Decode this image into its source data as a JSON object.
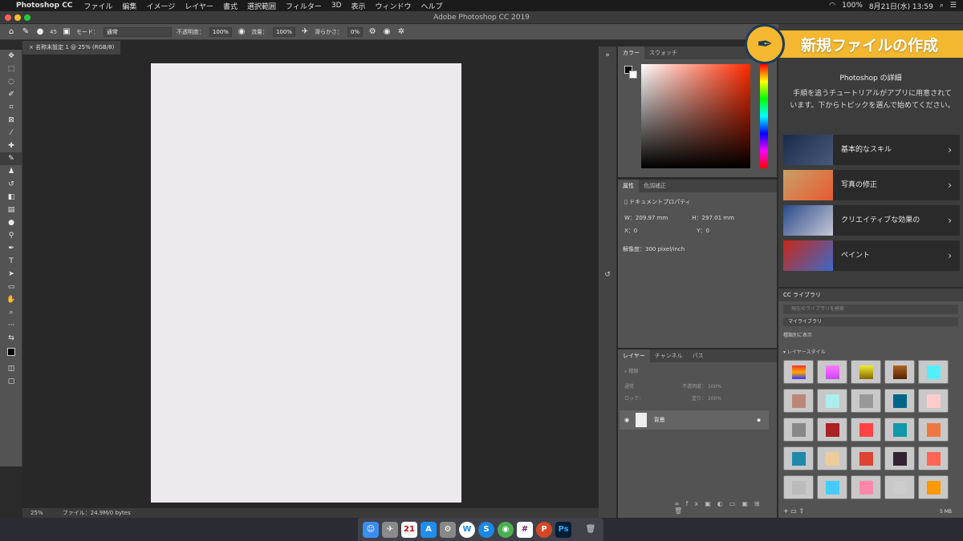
{
  "menubar": {
    "app": "Photoshop CC",
    "items": [
      "ファイル",
      "編集",
      "イメージ",
      "レイヤー",
      "書式",
      "選択範囲",
      "フィルター",
      "3D",
      "表示",
      "ウィンドウ",
      "ヘルプ"
    ],
    "battery": "100%",
    "datetime": "8月21日(水) 13:59"
  },
  "window": {
    "title": "Adobe Photoshop CC 2019"
  },
  "options": {
    "brush_size": "45",
    "mode_label": "モード：",
    "mode_value": "通常",
    "opacity_label": "不透明度：",
    "opacity_value": "100%",
    "flow_label": "流量：",
    "flow_value": "100%",
    "smoothing_label": "滑らかさ：",
    "smoothing_value": "0%"
  },
  "document": {
    "tab": "名称未設定 1 @ 25% (RGB/8)",
    "zoom": "25%",
    "file_info": "ファイル：24.9M/0 bytes"
  },
  "color_panel": {
    "tabs": [
      "カラー",
      "スウォッチ"
    ]
  },
  "properties_panel": {
    "tabs": [
      "属性",
      "色調補正"
    ],
    "heading": "ドキュメントプロパティ",
    "w": "W：209.97 mm",
    "h": "H：297.01 mm",
    "x": "X：0",
    "y": "Y：0",
    "resolution": "解像度：300 pixel/inch"
  },
  "layers_panel": {
    "tabs": [
      "レイヤー",
      "チャンネル",
      "パス"
    ],
    "filter": "種類",
    "blend": "通常",
    "opacity_label": "不透明度：",
    "opacity_value": "100%",
    "lock_label": "ロック：",
    "fill_label": "塗り：",
    "fill_value": "100%",
    "layer_name": "背景"
  },
  "learn_panel": {
    "banner": "新規ファイルの作成",
    "title": "Photoshop の詳細",
    "description": "手順を追うチュートリアルがアプリに用意されています。下からトピックを選んで始めてください。",
    "cards": [
      "基本的なスキル",
      "写真の修正",
      "クリエイティブな効果の",
      "ペイント"
    ]
  },
  "library_panel": {
    "title": "CC ライブラリ",
    "search_placeholder": "現在のライブラリを検索",
    "library": "マイライブラリ",
    "view_by": "種類別に表示",
    "section": "レイヤースタイル",
    "size": "5 MB"
  },
  "colors": {
    "accent_banner": "#f3b830",
    "photoshop_blue": "#31a8ff"
  }
}
